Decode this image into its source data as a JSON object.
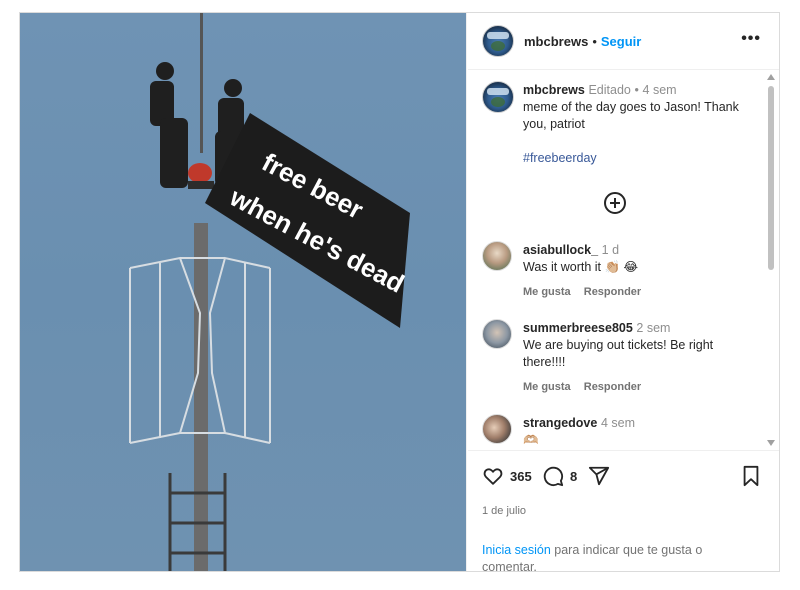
{
  "header": {
    "username": "mbcbrews",
    "separator": "•",
    "follow_label": "Seguir",
    "more_label": "•••"
  },
  "image": {
    "banner_line1": "free beer",
    "banner_line2": "when he's dead"
  },
  "caption": {
    "username": "mbcbrews",
    "edited": "Editado",
    "separator": "•",
    "time": "4 sem",
    "text": "meme of the day goes to Jason! Thank you, patriot",
    "hashtag": "#freebeerday"
  },
  "comments": [
    {
      "username": "asiabullock_",
      "time": "1 d",
      "text": "Was it worth it 👏🏼 😂",
      "like_label": "Me gusta",
      "reply_label": "Responder"
    },
    {
      "username": "summerbreese805",
      "time": "2 sem",
      "text": "We are buying out tickets! Be right there!!!!",
      "like_label": "Me gusta",
      "reply_label": "Responder"
    },
    {
      "username": "strangedove",
      "time": "4 sem",
      "text": "🫶🏼"
    }
  ],
  "actions": {
    "likes_count": "365",
    "comments_count": "8",
    "date": "1 de julio",
    "login_link": "Inicia sesión",
    "login_text": " para indicar que te gusta o comentar."
  },
  "icons": [
    "heart-icon",
    "comment-icon",
    "share-icon",
    "bookmark-icon",
    "add-circle-icon"
  ],
  "colors": {
    "link": "#0095f6",
    "hashtag": "#385898",
    "muted": "#737373",
    "text": "#262626"
  }
}
